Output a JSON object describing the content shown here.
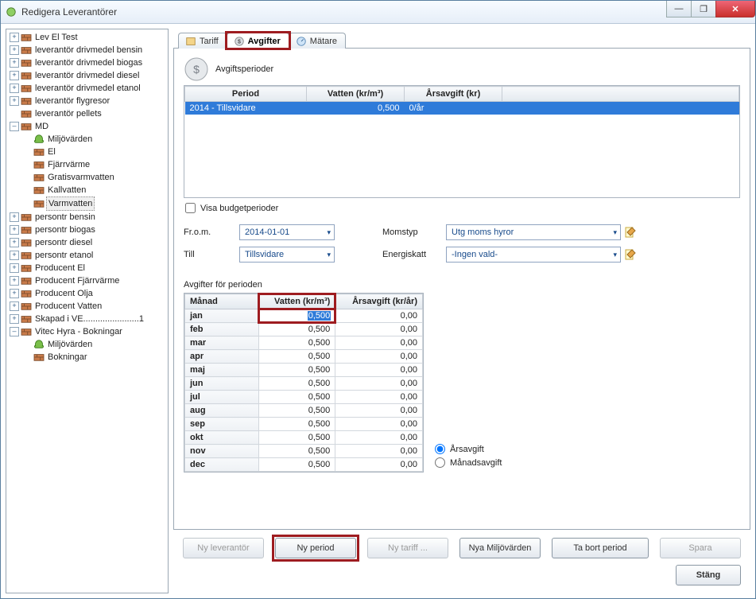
{
  "window": {
    "title": "Redigera Leverantörer",
    "faded_title": ""
  },
  "win_controls": {
    "min": "—",
    "max": "❐",
    "close": "✕"
  },
  "tree": {
    "items": [
      {
        "exp": "+",
        "icon": "brick",
        "label": "Lev El Test"
      },
      {
        "exp": "+",
        "icon": "brick",
        "label": "leverantör drivmedel bensin"
      },
      {
        "exp": "+",
        "icon": "brick",
        "label": "leverantör drivmedel biogas"
      },
      {
        "exp": "+",
        "icon": "brick",
        "label": "leverantör drivmedel diesel"
      },
      {
        "exp": "+",
        "icon": "brick",
        "label": "leverantör drivmedel etanol"
      },
      {
        "exp": "+",
        "icon": "brick",
        "label": "leverantör flygresor"
      },
      {
        "exp": "",
        "icon": "brick",
        "label": "leverantör pellets"
      },
      {
        "exp": "–",
        "icon": "brick",
        "label": "MD",
        "children": [
          {
            "exp": "",
            "icon": "green",
            "label": "Miljövärden"
          },
          {
            "exp": "",
            "icon": "brick",
            "label": "El"
          },
          {
            "exp": "",
            "icon": "brick",
            "label": "Fjärrvärme"
          },
          {
            "exp": "",
            "icon": "brick",
            "label": "Gratisvarmvatten"
          },
          {
            "exp": "",
            "icon": "brick",
            "label": "Kallvatten"
          },
          {
            "exp": "",
            "icon": "brick",
            "label": "Varmvatten",
            "selected": true
          }
        ]
      },
      {
        "exp": "+",
        "icon": "brick",
        "label": "persontr bensin"
      },
      {
        "exp": "+",
        "icon": "brick",
        "label": "persontr biogas"
      },
      {
        "exp": "+",
        "icon": "brick",
        "label": "persontr diesel"
      },
      {
        "exp": "+",
        "icon": "brick",
        "label": "persontr etanol"
      },
      {
        "exp": "+",
        "icon": "brick",
        "label": "Producent El"
      },
      {
        "exp": "+",
        "icon": "brick",
        "label": "Producent Fjärrvärme"
      },
      {
        "exp": "+",
        "icon": "brick",
        "label": "Producent Olja"
      },
      {
        "exp": "+",
        "icon": "brick",
        "label": "Producent Vatten"
      },
      {
        "exp": "+",
        "icon": "brick",
        "label": "Skapad i VE.......................1"
      },
      {
        "exp": "–",
        "icon": "brick",
        "label": "Vitec Hyra - Bokningar",
        "children": [
          {
            "exp": "",
            "icon": "green",
            "label": "Miljövärden"
          },
          {
            "exp": "",
            "icon": "brick",
            "label": "Bokningar"
          }
        ]
      }
    ]
  },
  "tabs": {
    "tariff": "Tariff",
    "avgifter": "Avgifter",
    "matare": "Mätare"
  },
  "periods": {
    "heading": "Avgiftsperioder",
    "cols": {
      "period": "Period",
      "vatten": "Vatten (kr/m³)",
      "arsavgift": "Årsavgift (kr)"
    },
    "rows": [
      {
        "period": "2014 - Tillsvidare",
        "vatten": "0,500",
        "arsavgift": "0/år"
      }
    ]
  },
  "show_budget": "Visa budgetperioder",
  "form": {
    "from_label": "Fr.o.m.",
    "from_value": "2014-01-01",
    "till_label": "Till",
    "till_value": "Tillsvidare",
    "moms_label": "Momstyp",
    "moms_value": "Utg moms hyror",
    "energi_label": "Energiskatt",
    "energi_value": "-Ingen vald-"
  },
  "month_section": {
    "title": "Avgifter för perioden",
    "cols": {
      "manad": "Månad",
      "vatten": "Vatten (kr/m³)",
      "arsavgift": "Årsavgift (kr/år)"
    },
    "jan_edit": "0,500",
    "rows": [
      {
        "m": "jan",
        "v": "0,500",
        "a": "0,00"
      },
      {
        "m": "feb",
        "v": "0,500",
        "a": "0,00"
      },
      {
        "m": "mar",
        "v": "0,500",
        "a": "0,00"
      },
      {
        "m": "apr",
        "v": "0,500",
        "a": "0,00"
      },
      {
        "m": "maj",
        "v": "0,500",
        "a": "0,00"
      },
      {
        "m": "jun",
        "v": "0,500",
        "a": "0,00"
      },
      {
        "m": "jul",
        "v": "0,500",
        "a": "0,00"
      },
      {
        "m": "aug",
        "v": "0,500",
        "a": "0,00"
      },
      {
        "m": "sep",
        "v": "0,500",
        "a": "0,00"
      },
      {
        "m": "okt",
        "v": "0,500",
        "a": "0,00"
      },
      {
        "m": "nov",
        "v": "0,500",
        "a": "0,00"
      },
      {
        "m": "dec",
        "v": "0,500",
        "a": "0,00"
      }
    ],
    "radio_year": "Årsavgift",
    "radio_month": "Månadsavgift"
  },
  "buttons": {
    "ny_lev": "Ny leverantör",
    "ny_period": "Ny period",
    "ny_tariff": "Ny tariff ...",
    "nya_miljo": "Nya Miljövärden",
    "ta_bort": "Ta bort period",
    "spara": "Spara",
    "stang": "Stäng"
  }
}
